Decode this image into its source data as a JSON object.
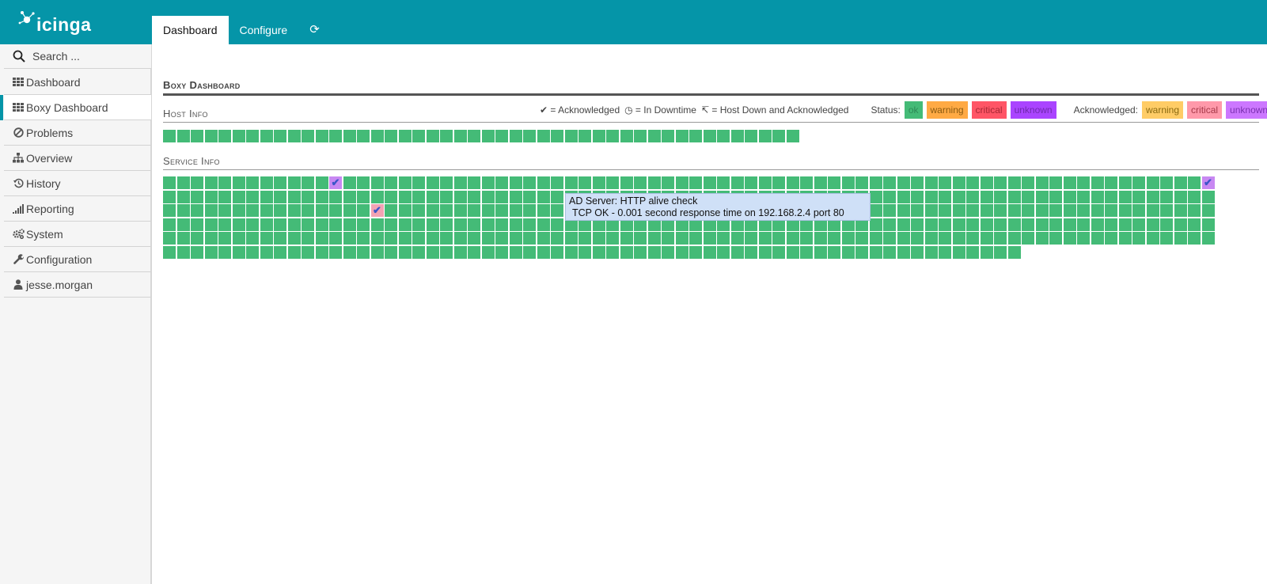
{
  "app": {
    "logo_text": "icinga"
  },
  "tabs": [
    {
      "label": "Dashboard",
      "active": true
    },
    {
      "label": "Configure",
      "active": false
    },
    {
      "label": "⟳",
      "icon": "refresh-icon"
    }
  ],
  "search": {
    "placeholder": "Search ..."
  },
  "nav": {
    "items": [
      {
        "label": "Dashboard",
        "icon": "grid-icon"
      },
      {
        "label": "Boxy Dashboard",
        "icon": "grid-icon",
        "active": true
      },
      {
        "label": "Problems",
        "icon": "ban-icon"
      },
      {
        "label": "Overview",
        "icon": "sitemap-icon"
      },
      {
        "label": "History",
        "icon": "history-icon"
      },
      {
        "label": "Reporting",
        "icon": "bar-chart-icon"
      },
      {
        "label": "System",
        "icon": "cogs-icon"
      },
      {
        "label": "Configuration",
        "icon": "wrench-icon"
      },
      {
        "label": "jesse.morgan",
        "icon": "user-icon"
      }
    ]
  },
  "dashboard": {
    "title": "Boxy Dashboard",
    "host_title": "Host Info",
    "service_title": "Service Info"
  },
  "legend": {
    "acknowledged": "✔ = Acknowledged",
    "downtime": "◷ = In Downtime",
    "host_down_ack": "↸ = Host Down and Acknowledged",
    "status_label": "Status:",
    "status": [
      {
        "label": "ok",
        "bg": "#44bb77",
        "fg": "#2d8a56"
      },
      {
        "label": "warning",
        "bg": "#ffaa44",
        "fg": "#8a5a10"
      },
      {
        "label": "critical",
        "bg": "#ff5566",
        "fg": "#a52834"
      },
      {
        "label": "unknown",
        "bg": "#aa44ff",
        "fg": "#7028ad"
      }
    ],
    "ack_label": "Acknowledged:",
    "acknowledged_status": [
      {
        "label": "warning",
        "bg": "#ffcc66",
        "fg": "#8a6a10"
      },
      {
        "label": "critical",
        "bg": "#ff99aa",
        "fg": "#a53848"
      },
      {
        "label": "unknown",
        "bg": "#cc77ff",
        "fg": "#7a30b0"
      }
    ]
  },
  "hosts": {
    "count": 46,
    "state": "ok"
  },
  "services": {
    "count": 442,
    "per_row": 76,
    "state": "ok",
    "special": [
      {
        "index": 12,
        "state": "unknown",
        "acknowledged": true,
        "mark": "✔"
      },
      {
        "index": 75,
        "state": "unknown",
        "acknowledged": true,
        "mark": "✔"
      },
      {
        "index": 167,
        "state": "critical",
        "acknowledged": true,
        "mark": "✔"
      }
    ]
  },
  "tooltip": {
    "line1": "AD Server: HTTP alive check",
    "line2": "TCP OK - 0.001 second response time on 192.168.2.4 port 80"
  },
  "colors": {
    "accent": "#0595a8",
    "ok": "#44bb77"
  }
}
